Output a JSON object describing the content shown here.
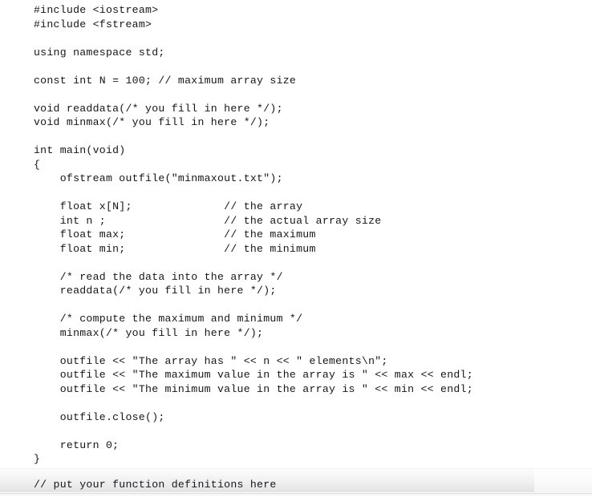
{
  "document": {
    "language": "cpp",
    "background_color": "#ffffff",
    "text_color": "#15161a",
    "code_lines": [
      "#include <iostream>",
      "#include <fstream>",
      "",
      "using namespace std;",
      "",
      "const int N = 100; // maximum array size",
      "",
      "void readdata(/* you fill in here */);",
      "void minmax(/* you fill in here */);",
      "",
      "int main(void)",
      "{",
      "    ofstream outfile(\"minmaxout.txt\");",
      "",
      "    float x[N];              // the array",
      "    int n ;                  // the actual array size",
      "    float max;               // the maximum",
      "    float min;               // the minimum",
      "",
      "    /* read the data into the array */",
      "    readdata(/* you fill in here */);",
      "",
      "    /* compute the maximum and minimum */",
      "    minmax(/* you fill in here */);",
      "",
      "    outfile << \"The array has \" << n << \" elements\\n\";",
      "    outfile << \"The maximum value in the array is \" << max << endl;",
      "    outfile << \"The minimum value in the array is \" << min << endl;",
      "",
      "    outfile.close();",
      "",
      "    return 0;",
      "}"
    ]
  },
  "footer": {
    "comment": "// put your function definitions here",
    "band_color_top": "#fdfdfd",
    "band_color_bottom": "#e2e2e2",
    "band_border_color": "#d6d6d6"
  }
}
